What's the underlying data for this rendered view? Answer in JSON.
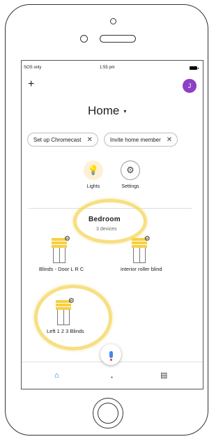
{
  "status_bar": {
    "carrier": "SOS only",
    "time": "1:55 pm"
  },
  "header": {
    "add_label": "+",
    "avatar_initial": "J",
    "title": "Home",
    "title_caret": "▾"
  },
  "chips": [
    {
      "label": "Set up Chromecast",
      "close": "✕"
    },
    {
      "label": "Invite home member",
      "close": "✕"
    }
  ],
  "quick_actions": [
    {
      "label": "Lights",
      "icon": "lightbulb-icon",
      "glyph": "💡"
    },
    {
      "label": "Settings",
      "icon": "gear-icon",
      "glyph": "⚙"
    }
  ],
  "room": {
    "name": "Bedroom",
    "subtitle": "3 devices"
  },
  "devices": [
    {
      "label": "Blinds - Door L R C",
      "icon": "blind-icon"
    },
    {
      "label": "interior roller blind",
      "icon": "blind-icon"
    },
    {
      "label": "Left 1 2 3 Blinds",
      "icon": "blind-icon"
    }
  ],
  "bottom_nav": {
    "home_glyph": "⌂",
    "mid_glyph": "●",
    "list_glyph": "▤"
  },
  "colors": {
    "accent": "#1a73e8",
    "avatar": "#8e3fc4",
    "blind_yellow": "#f8cf43",
    "highlight": "#f4d45a"
  }
}
